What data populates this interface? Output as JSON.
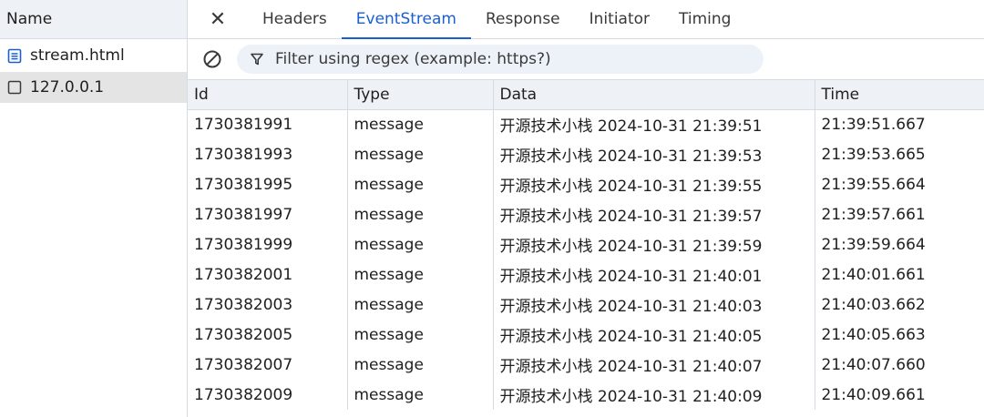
{
  "request_list": {
    "header": "Name",
    "items": [
      {
        "label": "stream.html",
        "icon": "document-icon",
        "selected": false
      },
      {
        "label": "127.0.0.1",
        "icon": "checkbox-icon",
        "selected": true
      }
    ]
  },
  "tabs": {
    "close_glyph": "✕",
    "items": [
      {
        "label": "Headers",
        "active": false
      },
      {
        "label": "EventStream",
        "active": true
      },
      {
        "label": "Response",
        "active": false
      },
      {
        "label": "Initiator",
        "active": false
      },
      {
        "label": "Timing",
        "active": false
      }
    ]
  },
  "toolbar": {
    "filter_placeholder": "Filter using regex (example: https?)",
    "filter_value": ""
  },
  "table": {
    "columns": [
      "Id",
      "Type",
      "Data",
      "Time"
    ],
    "rows": [
      [
        "1730381991",
        "message",
        "开源技术小栈 2024-10-31 21:39:51",
        "21:39:51.667"
      ],
      [
        "1730381993",
        "message",
        "开源技术小栈 2024-10-31 21:39:53",
        "21:39:53.665"
      ],
      [
        "1730381995",
        "message",
        "开源技术小栈 2024-10-31 21:39:55",
        "21:39:55.664"
      ],
      [
        "1730381997",
        "message",
        "开源技术小栈 2024-10-31 21:39:57",
        "21:39:57.661"
      ],
      [
        "1730381999",
        "message",
        "开源技术小栈 2024-10-31 21:39:59",
        "21:39:59.664"
      ],
      [
        "1730382001",
        "message",
        "开源技术小栈 2024-10-31 21:40:01",
        "21:40:01.661"
      ],
      [
        "1730382003",
        "message",
        "开源技术小栈 2024-10-31 21:40:03",
        "21:40:03.662"
      ],
      [
        "1730382005",
        "message",
        "开源技术小栈 2024-10-31 21:40:05",
        "21:40:05.663"
      ],
      [
        "1730382007",
        "message",
        "开源技术小栈 2024-10-31 21:40:07",
        "21:40:07.660"
      ],
      [
        "1730382009",
        "message",
        "开源技术小栈 2024-10-31 21:40:09",
        "21:40:09.661"
      ]
    ]
  },
  "colors": {
    "accent": "#1a5fd0",
    "header_bg": "#eef1f6",
    "border": "#d6dbe3",
    "selected_bg": "#e4e4e4",
    "filter_bg": "#edf2f9"
  }
}
